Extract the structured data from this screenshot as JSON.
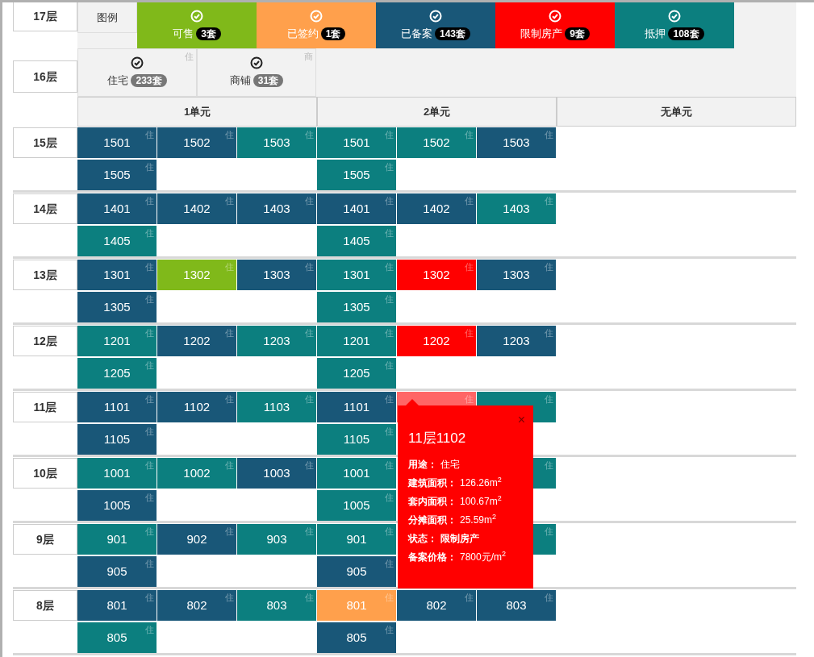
{
  "legend_title": "图例",
  "statuses": [
    {
      "label": "可售",
      "count": "3套",
      "color": "#80b91a"
    },
    {
      "label": "已签约",
      "count": "1套",
      "color": "#ffa04c"
    },
    {
      "label": "已备案",
      "count": "143套",
      "color": "#195778"
    },
    {
      "label": "限制房产",
      "count": "9套",
      "color": "#ff0000"
    },
    {
      "label": "抵押",
      "count": "108套",
      "color": "#0c7f7f"
    }
  ],
  "usages": [
    {
      "label": "住宅",
      "count": "233套",
      "mark": "住"
    },
    {
      "label": "商铺",
      "count": "31套",
      "mark": "商"
    }
  ],
  "top_floors": [
    "17层",
    "16层"
  ],
  "units": [
    "1单元",
    "2单元",
    "无单元"
  ],
  "floors": [
    {
      "label": "15层",
      "units": [
        [
          {
            "column_1": {
              "number": "1501",
              "color": "#195778",
              "mark": "住",
              "selected": false
            },
            "column_2": {
              "number": "1502",
              "color": "#195778",
              "mark": "住",
              "selected": false
            },
            "column_3": {
              "number": "1503",
              "color": "#0c7f7f",
              "mark": "住",
              "selected": false
            }
          },
          {
            "column_1": {
              "number": "1505",
              "color": "#195778",
              "mark": "住",
              "selected": false
            }
          }
        ],
        [
          {
            "column_1": {
              "number": "1501",
              "color": "#0c7f7f",
              "mark": "住",
              "selected": false
            },
            "column_2": {
              "number": "1502",
              "color": "#0c7f7f",
              "mark": "住",
              "selected": false
            },
            "column_3": {
              "number": "1503",
              "color": "#195778",
              "mark": "住",
              "selected": false
            }
          },
          {
            "column_1": {
              "number": "1505",
              "color": "#0c7f7f",
              "mark": "住",
              "selected": false
            }
          }
        ]
      ]
    },
    {
      "label": "14层",
      "units": [
        [
          {
            "column_1": {
              "number": "1401",
              "color": "#195778",
              "mark": "住",
              "selected": false
            },
            "column_2": {
              "number": "1402",
              "color": "#195778",
              "mark": "住",
              "selected": false
            },
            "column_3": {
              "number": "1403",
              "color": "#195778",
              "mark": "住",
              "selected": false
            }
          },
          {
            "column_1": {
              "number": "1405",
              "color": "#0c7f7f",
              "mark": "住",
              "selected": false
            }
          }
        ],
        [
          {
            "column_1": {
              "number": "1401",
              "color": "#195778",
              "mark": "住",
              "selected": false
            },
            "column_2": {
              "number": "1402",
              "color": "#195778",
              "mark": "住",
              "selected": false
            },
            "column_3": {
              "number": "1403",
              "color": "#0c7f7f",
              "mark": "住",
              "selected": false
            }
          },
          {
            "column_1": {
              "number": "1405",
              "color": "#0c7f7f",
              "mark": "住",
              "selected": false
            }
          }
        ]
      ]
    },
    {
      "label": "13层",
      "units": [
        [
          {
            "column_1": {
              "number": "1301",
              "color": "#195778",
              "mark": "住",
              "selected": false
            },
            "column_2": {
              "number": "1302",
              "color": "#80b91a",
              "mark": "住",
              "selected": false
            },
            "column_3": {
              "number": "1303",
              "color": "#195778",
              "mark": "住",
              "selected": false
            }
          },
          {
            "column_1": {
              "number": "1305",
              "color": "#195778",
              "mark": "住",
              "selected": false
            }
          }
        ],
        [
          {
            "column_1": {
              "number": "1301",
              "color": "#0c7f7f",
              "mark": "住",
              "selected": false
            },
            "column_2": {
              "number": "1302",
              "color": "#ff0000",
              "mark": "住",
              "selected": false
            },
            "column_3": {
              "number": "1303",
              "color": "#195778",
              "mark": "住",
              "selected": false
            }
          },
          {
            "column_1": {
              "number": "1305",
              "color": "#0c7f7f",
              "mark": "住",
              "selected": false
            }
          }
        ]
      ]
    },
    {
      "label": "12层",
      "units": [
        [
          {
            "column_1": {
              "number": "1201",
              "color": "#0c7f7f",
              "mark": "住",
              "selected": false
            },
            "column_2": {
              "number": "1202",
              "color": "#195778",
              "mark": "住",
              "selected": false
            },
            "column_3": {
              "number": "1203",
              "color": "#0c7f7f",
              "mark": "住",
              "selected": false
            }
          },
          {
            "column_1": {
              "number": "1205",
              "color": "#0c7f7f",
              "mark": "住",
              "selected": false
            }
          }
        ],
        [
          {
            "column_1": {
              "number": "1201",
              "color": "#0c7f7f",
              "mark": "住",
              "selected": false
            },
            "column_2": {
              "number": "1202",
              "color": "#ff0000",
              "mark": "住",
              "selected": false
            },
            "column_3": {
              "number": "1203",
              "color": "#195778",
              "mark": "住",
              "selected": false
            }
          },
          {
            "column_1": {
              "number": "1205",
              "color": "#0c7f7f",
              "mark": "住",
              "selected": false
            }
          }
        ]
      ]
    },
    {
      "label": "11层",
      "units": [
        [
          {
            "column_1": {
              "number": "1101",
              "color": "#195778",
              "mark": "住",
              "selected": false
            },
            "column_2": {
              "number": "1102",
              "color": "#195778",
              "mark": "住",
              "selected": false
            },
            "column_3": {
              "number": "1103",
              "color": "#0c7f7f",
              "mark": "住",
              "selected": false
            }
          },
          {
            "column_1": {
              "number": "1105",
              "color": "#195778",
              "mark": "住",
              "selected": false
            }
          }
        ],
        [
          {
            "column_1": {
              "number": "1101",
              "color": "#195778",
              "mark": "住",
              "selected": false
            },
            "column_2": {
              "color": "#ff0000",
              "mark": "住",
              "selected": true
            },
            "column_3": {
              "color": "#0c7f7f",
              "mark": "住",
              "selected": false
            }
          },
          {
            "column_1": {
              "number": "1105",
              "color": "#0c7f7f",
              "mark": "住",
              "selected": false
            }
          }
        ]
      ]
    },
    {
      "label": "10层",
      "units": [
        [
          {
            "column_1": {
              "number": "1001",
              "color": "#0c7f7f",
              "mark": "住",
              "selected": false
            },
            "column_2": {
              "number": "1002",
              "color": "#0c7f7f",
              "mark": "住",
              "selected": false
            },
            "column_3": {
              "number": "1003",
              "color": "#195778",
              "mark": "住",
              "selected": false
            }
          },
          {
            "column_1": {
              "number": "1005",
              "color": "#195778",
              "mark": "住",
              "selected": false
            }
          }
        ],
        [
          {
            "column_1": {
              "number": "1001",
              "color": "#0c7f7f",
              "mark": "住",
              "selected": false
            },
            "column_3": {
              "color": "#0c7f7f",
              "mark": "住",
              "selected": false
            }
          },
          {
            "column_1": {
              "number": "1005",
              "color": "#0c7f7f",
              "mark": "住",
              "selected": false
            }
          }
        ]
      ]
    },
    {
      "label": "9层",
      "units": [
        [
          {
            "column_1": {
              "number": "901",
              "color": "#0c7f7f",
              "mark": "住",
              "selected": false
            },
            "column_2": {
              "number": "902",
              "color": "#195778",
              "mark": "住",
              "selected": false
            },
            "column_3": {
              "number": "903",
              "color": "#0c7f7f",
              "mark": "住",
              "selected": false
            }
          },
          {
            "column_1": {
              "number": "905",
              "color": "#195778",
              "mark": "住",
              "selected": false
            }
          }
        ],
        [
          {
            "column_1": {
              "number": "901",
              "color": "#0c7f7f",
              "mark": "住",
              "selected": false
            },
            "column_3": {
              "color": "#0c7f7f",
              "mark": "住",
              "selected": false
            }
          },
          {
            "column_1": {
              "number": "905",
              "color": "#195778",
              "mark": "住",
              "selected": false
            }
          }
        ]
      ]
    },
    {
      "label": "8层",
      "units": [
        [
          {
            "column_1": {
              "number": "801",
              "color": "#195778",
              "mark": "住",
              "selected": false
            },
            "column_2": {
              "number": "802",
              "color": "#195778",
              "mark": "住",
              "selected": false
            },
            "column_3": {
              "number": "803",
              "color": "#0c7f7f",
              "mark": "住",
              "selected": false
            }
          },
          {
            "column_1": {
              "number": "805",
              "color": "#0c7f7f",
              "mark": "住",
              "selected": false
            }
          }
        ],
        [
          {
            "column_1": {
              "number": "801",
              "color": "#ffa04c",
              "mark": "住",
              "selected": false
            },
            "column_2": {
              "number": "802",
              "color": "#195778",
              "mark": "住",
              "selected": false
            },
            "column_3": {
              "number": "803",
              "color": "#195778",
              "mark": "住",
              "selected": false
            }
          },
          {
            "column_1": {
              "number": "805",
              "color": "#195778",
              "mark": "住",
              "selected": false
            }
          }
        ]
      ]
    }
  ],
  "tooltip": {
    "title": "11层1102",
    "close": "×",
    "fields": [
      {
        "label": "用途：",
        "value": "住宅"
      },
      {
        "label": "建筑面积：",
        "value": "126.26m$^{2}$"
      },
      {
        "label": "套内面积：",
        "value": "100.67m$^{2}$"
      },
      {
        "label": "分摊面积：",
        "value": "25.59m$^{2}$"
      },
      {
        "label": "状态：",
        "value": "**限制房产**"
      },
      {
        "label": "备案价格：",
        "value": "7800元/m$^{2}$"
      }
    ]
  }
}
